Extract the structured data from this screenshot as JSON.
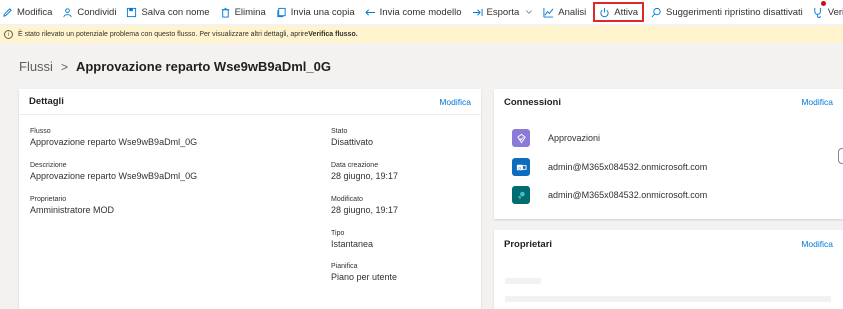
{
  "toolbar": {
    "items": [
      {
        "label": "Modifica",
        "icon": "pencil-icon"
      },
      {
        "label": "Condividi",
        "icon": "share-icon"
      },
      {
        "label": "Salva con nome",
        "icon": "save-as-icon"
      },
      {
        "label": "Elimina",
        "icon": "trash-icon"
      },
      {
        "label": "Invia una copia",
        "icon": "copy-icon"
      },
      {
        "label": "Invia come modello",
        "icon": "arrow-left-icon"
      },
      {
        "label": "Esporta",
        "icon": "export-icon"
      },
      {
        "label": "Analisi",
        "icon": "analytics-icon"
      },
      {
        "label": "Attiva",
        "icon": "power-icon"
      },
      {
        "label": "Suggerimenti ripristino disattivati",
        "icon": "search-icon"
      },
      {
        "label": "Verific",
        "icon": "stethoscope-icon"
      }
    ]
  },
  "notice": {
    "text": "È stato rilevato un potenziale problema con questo flusso. Per visualizzare altri dettagli, aprire ",
    "link": "Verifica flusso."
  },
  "breadcrumb": {
    "root": "Flussi",
    "separator": ">",
    "title": "Approvazione reparto Wse9wB9aDml_0G"
  },
  "details": {
    "title": "Dettagli",
    "action": "Modifica",
    "left": [
      {
        "label": "Flusso",
        "value": "Approvazione reparto Wse9wB9aDml_0G"
      },
      {
        "label": "Descrizione",
        "value": "Approvazione reparto Wse9wB9aDml_0G"
      },
      {
        "label": "Proprietario",
        "value": "Amministratore MOD"
      }
    ],
    "right": [
      {
        "label": "Stato",
        "value": "Disattivato"
      },
      {
        "label": "Data creazione",
        "value": "28 giugno, 19:17"
      },
      {
        "label": "Modificato",
        "value": "28 giugno, 19:17"
      },
      {
        "label": "Tipo",
        "value": "Istantanea"
      },
      {
        "label": "Pianifica",
        "value": "Piano per utente"
      }
    ]
  },
  "connections": {
    "title": "Connessioni",
    "action": "Modifica",
    "items": [
      {
        "label": "Approvazioni",
        "icon": "approvals-icon",
        "color": "#8b7ad6"
      },
      {
        "label": "admin@M365x084532.onmicrosoft.com",
        "icon": "outlook-icon",
        "color": "#0f6cbd"
      },
      {
        "label": "admin@M365x084532.onmicrosoft.com",
        "icon": "sharepoint-icon",
        "color": "#036c70"
      }
    ]
  },
  "owners": {
    "title": "Proprietari",
    "action": "Modifica"
  },
  "colors": {
    "accent": "#0078d4",
    "warning_bg": "#fff4ce",
    "highlight_border": "#e02828"
  }
}
